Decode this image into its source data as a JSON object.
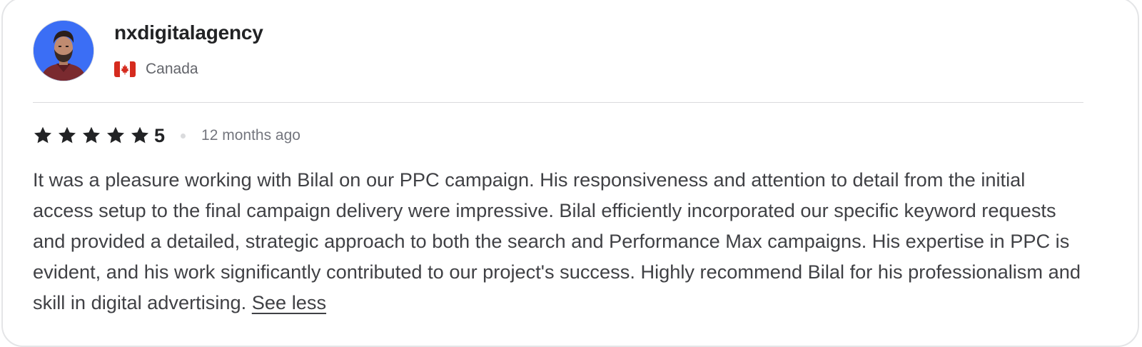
{
  "review": {
    "username": "nxdigitalagency",
    "country": "Canada",
    "rating": "5",
    "stars": 5,
    "time_ago": "12 months ago",
    "text": "It was a pleasure working with Bilal on our PPC campaign. His responsiveness and attention to detail from the initial access setup to the final campaign delivery were impressive. Bilal efficiently incorporated our specific keyword requests and provided a detailed, strategic approach to both the search and Performance Max campaigns. His expertise in PPC is evident, and his work significantly contributed to our project's success. Highly recommend Bilal for his professionalism and skill in digital advertising.",
    "see_less_label": "See less"
  },
  "icons": {
    "avatar": "user-avatar-photo",
    "flag": "canada-flag-icon",
    "star": "star-icon"
  },
  "colors": {
    "text_primary": "#222325",
    "text_body": "#404145",
    "text_muted": "#74767e",
    "avatar_bg": "#3b6ef5",
    "flag_red": "#d52b1e"
  }
}
